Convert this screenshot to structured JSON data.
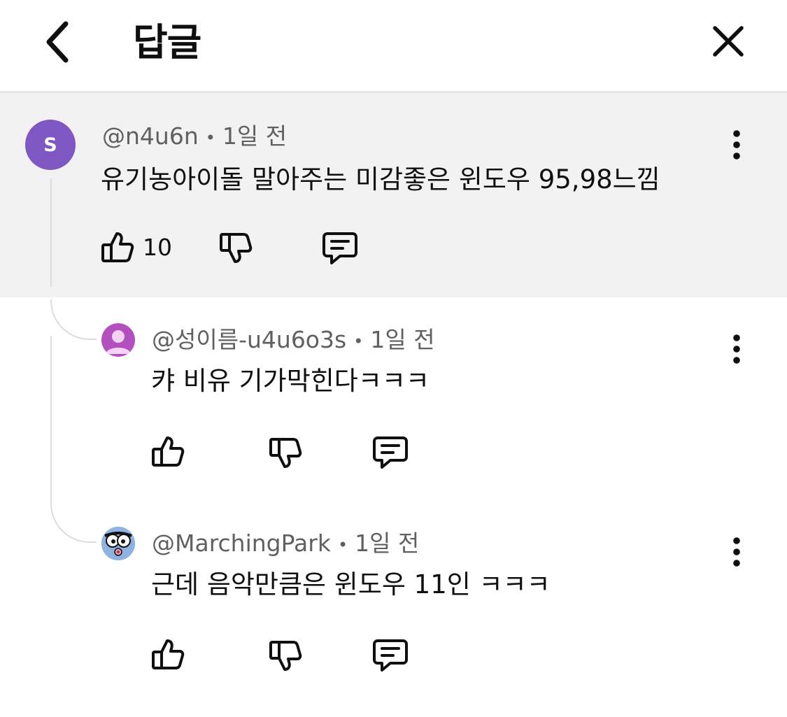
{
  "header": {
    "title": "답글",
    "back_icon": "chevron-left-icon",
    "close_icon": "close-icon"
  },
  "main_comment": {
    "avatar_letter": "S",
    "avatar_color": "#7e57c2",
    "author": "@n4u6n",
    "separator": "•",
    "time": "1일 전",
    "text": "유기농아이돌 말아주는 미감좋은 윈도우 95,98느낌",
    "like_count": "10"
  },
  "replies": [
    {
      "author": "@성이름-u4u6o3s",
      "separator": "•",
      "time": "1일 전",
      "text": "캬 비유 기가막힌다ㅋㅋㅋ",
      "avatar_color": "#b44fc0"
    },
    {
      "author": "@MarchingPark",
      "separator": "•",
      "time": "1일 전",
      "text": "근데 음악만큼은 윈도우 11인 ㅋㅋㅋ",
      "avatar_color": "#7fa7d9"
    }
  ],
  "colors": {
    "highlight_bg": "#f2f2f2",
    "meta_text": "#606060",
    "divider": "#e5e5e5"
  }
}
